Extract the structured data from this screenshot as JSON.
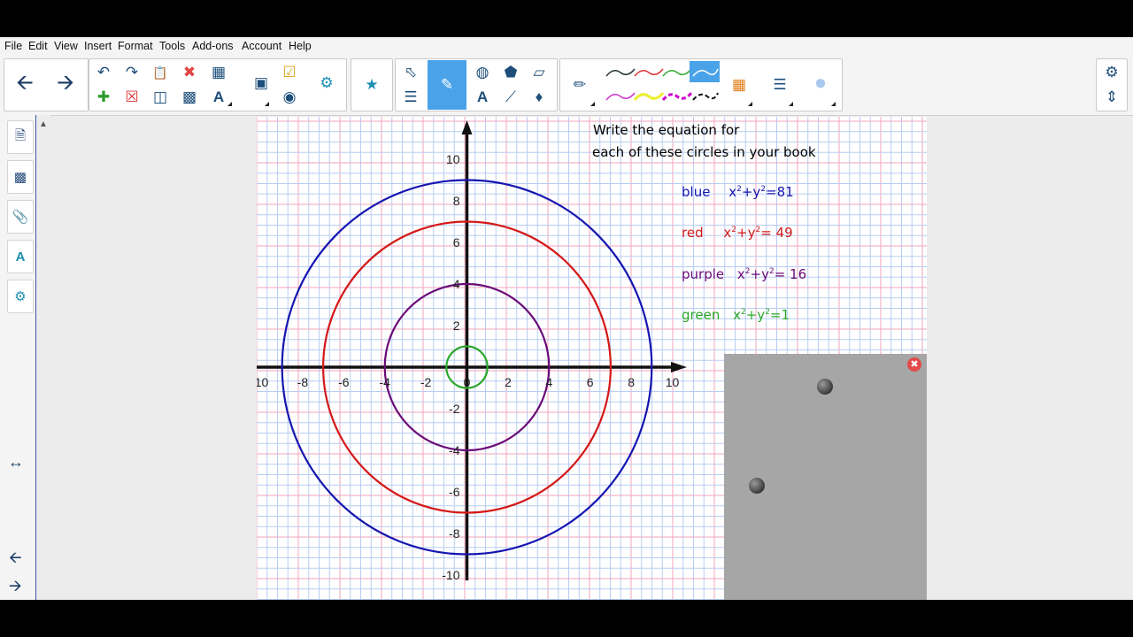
{
  "menu": [
    "File",
    "Edit",
    "View",
    "Insert",
    "Format",
    "Tools",
    "Add-ons",
    "Account",
    "Help"
  ],
  "toolbar": {
    "back_icon": "arrow-left-icon",
    "forward_icon": "arrow-right-icon",
    "tools": [
      "undo-icon",
      "redo-icon",
      "paste-icon",
      "delete-icon",
      "table-icon",
      "new-page-icon",
      "clear-page-icon",
      "save-icon",
      "screen-shade-icon",
      "text-recognition-icon",
      "document-camera-icon",
      "capture-icon",
      "response-icon",
      "add-ons-icon",
      "puzzle-icon",
      "select-icon",
      "pen-icon",
      "shapes-icon",
      "fill-icon",
      "text-icon",
      "line-icon",
      "eraser-icon",
      "settings-icon",
      "move-toolbar-icon"
    ],
    "accent": "#4aa3e8"
  },
  "sidebar": {
    "tabs": [
      "page-sorter-icon",
      "gallery-icon",
      "attachments-icon",
      "properties-icon",
      "add-ons-icon"
    ],
    "resize_icon": "resize-horizontal-icon",
    "nav": [
      "previous-page-icon",
      "next-page-icon",
      "add-page-icon"
    ]
  },
  "notes": {
    "heading_line1": "Write the equation for",
    "heading_line2": "each of these circles in your book",
    "blue_label": "blue",
    "red_label": "red",
    "red_rhs": "= 49",
    "purple_label": "purple",
    "purple_rhs": "= 16",
    "green_label": "green",
    "green_rhs": "=1",
    "blue_rhs": "=81",
    "x": "x",
    "y": "+y",
    "exp": "2"
  },
  "colors": {
    "blue": "#1515b0",
    "red": "#d41818",
    "purple": "#6a0a78",
    "green": "#2aa82a",
    "heading": "#131380",
    "grid_red": "#f2a6b8",
    "grid_blue": "#b8cdf2"
  },
  "chart_data": {
    "type": "scatter",
    "title": "",
    "xlabel": "",
    "ylabel": "",
    "xlim": [
      -10,
      10
    ],
    "ylim": [
      -10,
      10
    ],
    "x_ticks": [
      -10,
      -8,
      -6,
      -4,
      -2,
      0,
      2,
      4,
      6,
      8,
      10
    ],
    "y_ticks": [
      10,
      8,
      6,
      4,
      2,
      -2,
      -4,
      -6,
      -8,
      -10
    ],
    "x_tick_labels": [
      "10",
      "-8",
      "-6",
      "-4",
      "-2",
      "0",
      "2",
      "4",
      "6",
      "8",
      "10"
    ],
    "y_tick_labels": [
      "10",
      "8",
      "6",
      "4",
      "2",
      "-2",
      "-4",
      "-6",
      "-8",
      "-10"
    ],
    "circles": [
      {
        "color": "blue",
        "radius": 9
      },
      {
        "color": "red",
        "radius": 7
      },
      {
        "color": "purple",
        "radius": 4
      },
      {
        "color": "green",
        "radius": 1
      }
    ],
    "grid": true
  },
  "panel": {
    "close_icon": "close-icon"
  }
}
